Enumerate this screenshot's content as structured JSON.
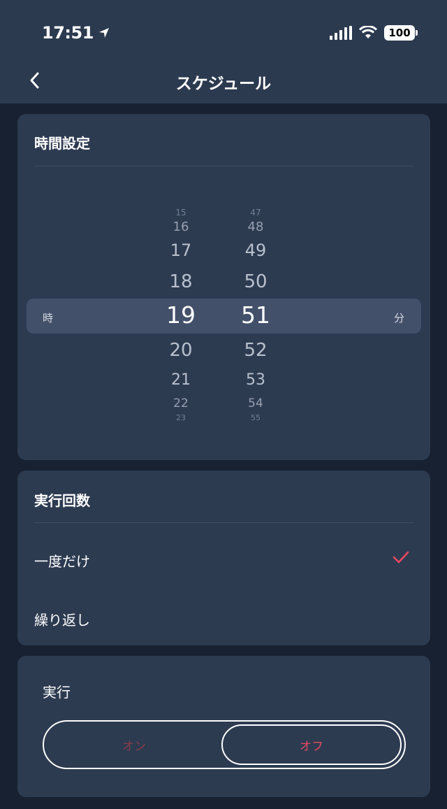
{
  "status_bar": {
    "time": "17:51",
    "battery": "100"
  },
  "header": {
    "title": "スケジュール"
  },
  "time_setting": {
    "title": "時間設定",
    "hour_unit": "時",
    "minute_unit": "分",
    "hours": [
      "15",
      "16",
      "17",
      "18",
      "19",
      "20",
      "21",
      "22",
      "23"
    ],
    "minutes": [
      "47",
      "48",
      "49",
      "50",
      "51",
      "52",
      "53",
      "54",
      "55"
    ],
    "selected_hour": "19",
    "selected_minute": "51"
  },
  "repeat": {
    "title": "実行回数",
    "options": [
      {
        "label": "一度だけ",
        "selected": true
      },
      {
        "label": "繰り返し",
        "selected": false
      }
    ]
  },
  "execute": {
    "title": "実行",
    "on_label": "オン",
    "off_label": "オフ",
    "selected": "off"
  },
  "colors": {
    "accent": "#e84a5f",
    "card": "#2d3b51",
    "background": "#172131"
  }
}
